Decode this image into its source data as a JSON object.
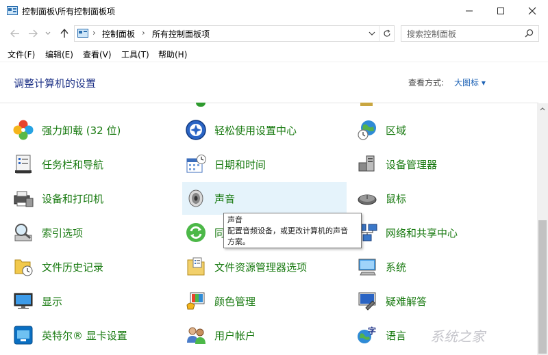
{
  "window": {
    "title": "控制面板\\所有控制面板项",
    "minimize": "—",
    "maximize": "☐",
    "close": "✕"
  },
  "address": {
    "crumbs": [
      "控制面板",
      "所有控制面板项"
    ],
    "separator": "›",
    "search_placeholder": "搜索控制面板"
  },
  "menu": [
    "文件(F)",
    "编辑(E)",
    "查看(V)",
    "工具(T)",
    "帮助(H)"
  ],
  "header": {
    "title": "调整计算机的设置",
    "view_by_label": "查看方式:",
    "view_by_value": "大图标 ▾"
  },
  "items": [
    {
      "label": "强力卸载 (32 位)",
      "icon": "clover-icon"
    },
    {
      "label": "轻松使用设置中心",
      "icon": "accessibility-icon"
    },
    {
      "label": "区域",
      "icon": "globe-clock-icon"
    },
    {
      "label": "任务栏和导航",
      "icon": "taskbar-icon"
    },
    {
      "label": "日期和时间",
      "icon": "calendar-icon"
    },
    {
      "label": "设备管理器",
      "icon": "device-manager-icon"
    },
    {
      "label": "设备和打印机",
      "icon": "printer-icon"
    },
    {
      "label": "声音",
      "icon": "speaker-icon"
    },
    {
      "label": "鼠标",
      "icon": "mouse-icon"
    },
    {
      "label": "索引选项",
      "icon": "magnifier-icon"
    },
    {
      "label": "同",
      "icon": "sync-icon"
    },
    {
      "label": "网络和共享中心",
      "icon": "network-icon"
    },
    {
      "label": "文件历史记录",
      "icon": "file-history-icon"
    },
    {
      "label": "文件资源管理器选项",
      "icon": "folder-options-icon"
    },
    {
      "label": "系统",
      "icon": "system-icon"
    },
    {
      "label": "显示",
      "icon": "monitor-icon"
    },
    {
      "label": "颜色管理",
      "icon": "color-management-icon"
    },
    {
      "label": "疑难解答",
      "icon": "troubleshoot-icon"
    },
    {
      "label": "英特尔® 显卡设置",
      "icon": "intel-graphics-icon"
    },
    {
      "label": "用户帐户",
      "icon": "users-icon"
    },
    {
      "label": "语言",
      "icon": "language-icon"
    }
  ],
  "tooltip": {
    "title": "声音",
    "line1": "配置音频设备，或更改计算机的声音",
    "line2": "方案。"
  },
  "watermark": "系统之家",
  "colors": {
    "link_green": "#187a10",
    "heading_blue": "#1e3287",
    "hover_bg": "#e5f3fb"
  }
}
